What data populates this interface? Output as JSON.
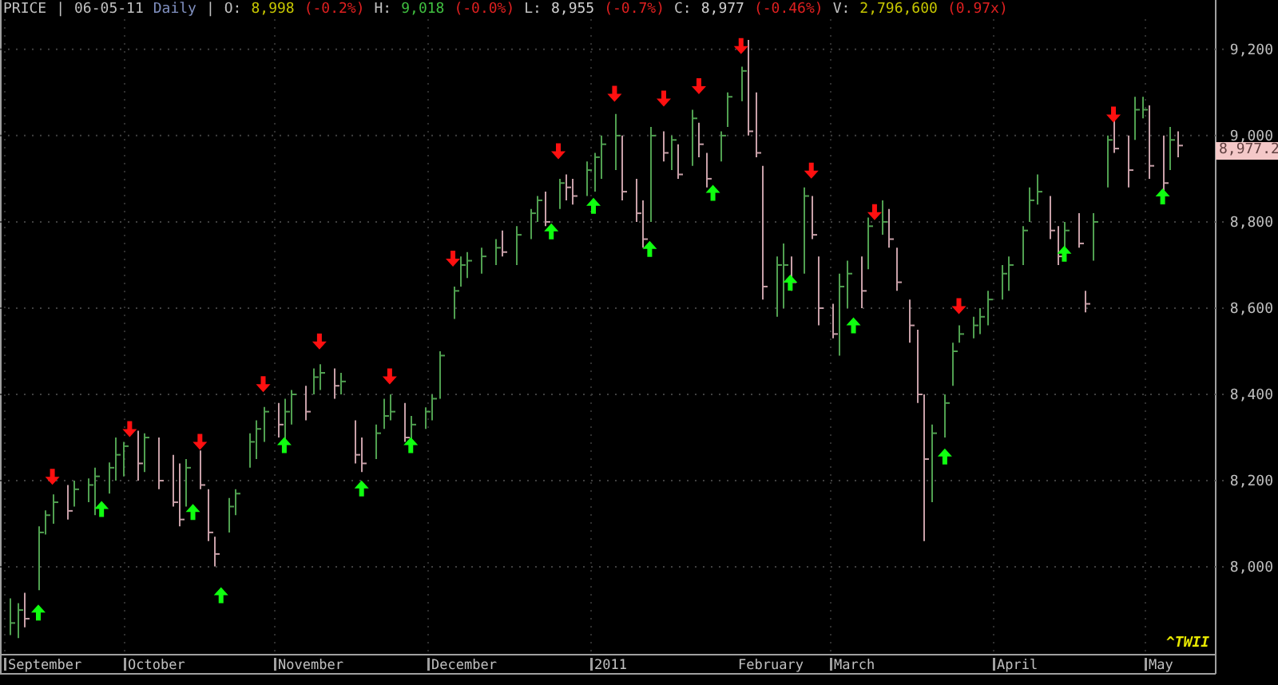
{
  "header": {
    "title": "PRICE",
    "separator_1": "|",
    "date": "06-05-11",
    "interval": "Daily",
    "separator_2": "|",
    "quotes": [
      {
        "label": "O:",
        "value": "8,998",
        "change": "(-0.2%)",
        "color": "#c8c800"
      },
      {
        "label": "H:",
        "value": "9,018",
        "change": "(-0.0%)",
        "color": "#40c040"
      },
      {
        "label": "L:",
        "value": "8,955",
        "change": "(-0.7%)",
        "color": "#d0d0d0"
      },
      {
        "label": "C:",
        "value": "8,977",
        "change": "(-0.46%)",
        "color": "#d0d0d0"
      },
      {
        "label": "V:",
        "value": "2,796,600",
        "change": "(0.97x)",
        "color": "#c8c800"
      }
    ]
  },
  "last_price_tag": "8,977.2",
  "symbol": "^TWII",
  "y_axis_labels": [
    "9,200",
    "9,000",
    "8,800",
    "8,600",
    "8,400",
    "8,200",
    "8,000"
  ],
  "x_axis_labels": [
    {
      "text": "September",
      "tick": true
    },
    {
      "text": "October",
      "tick": true
    },
    {
      "text": "November",
      "tick": true
    },
    {
      "text": "December",
      "tick": true
    },
    {
      "text": "2011",
      "tick": true
    },
    {
      "text": "February",
      "tick": false
    },
    {
      "text": "March",
      "tick": true
    },
    {
      "text": "April",
      "tick": true
    },
    {
      "text": "May",
      "tick": true
    }
  ]
}
